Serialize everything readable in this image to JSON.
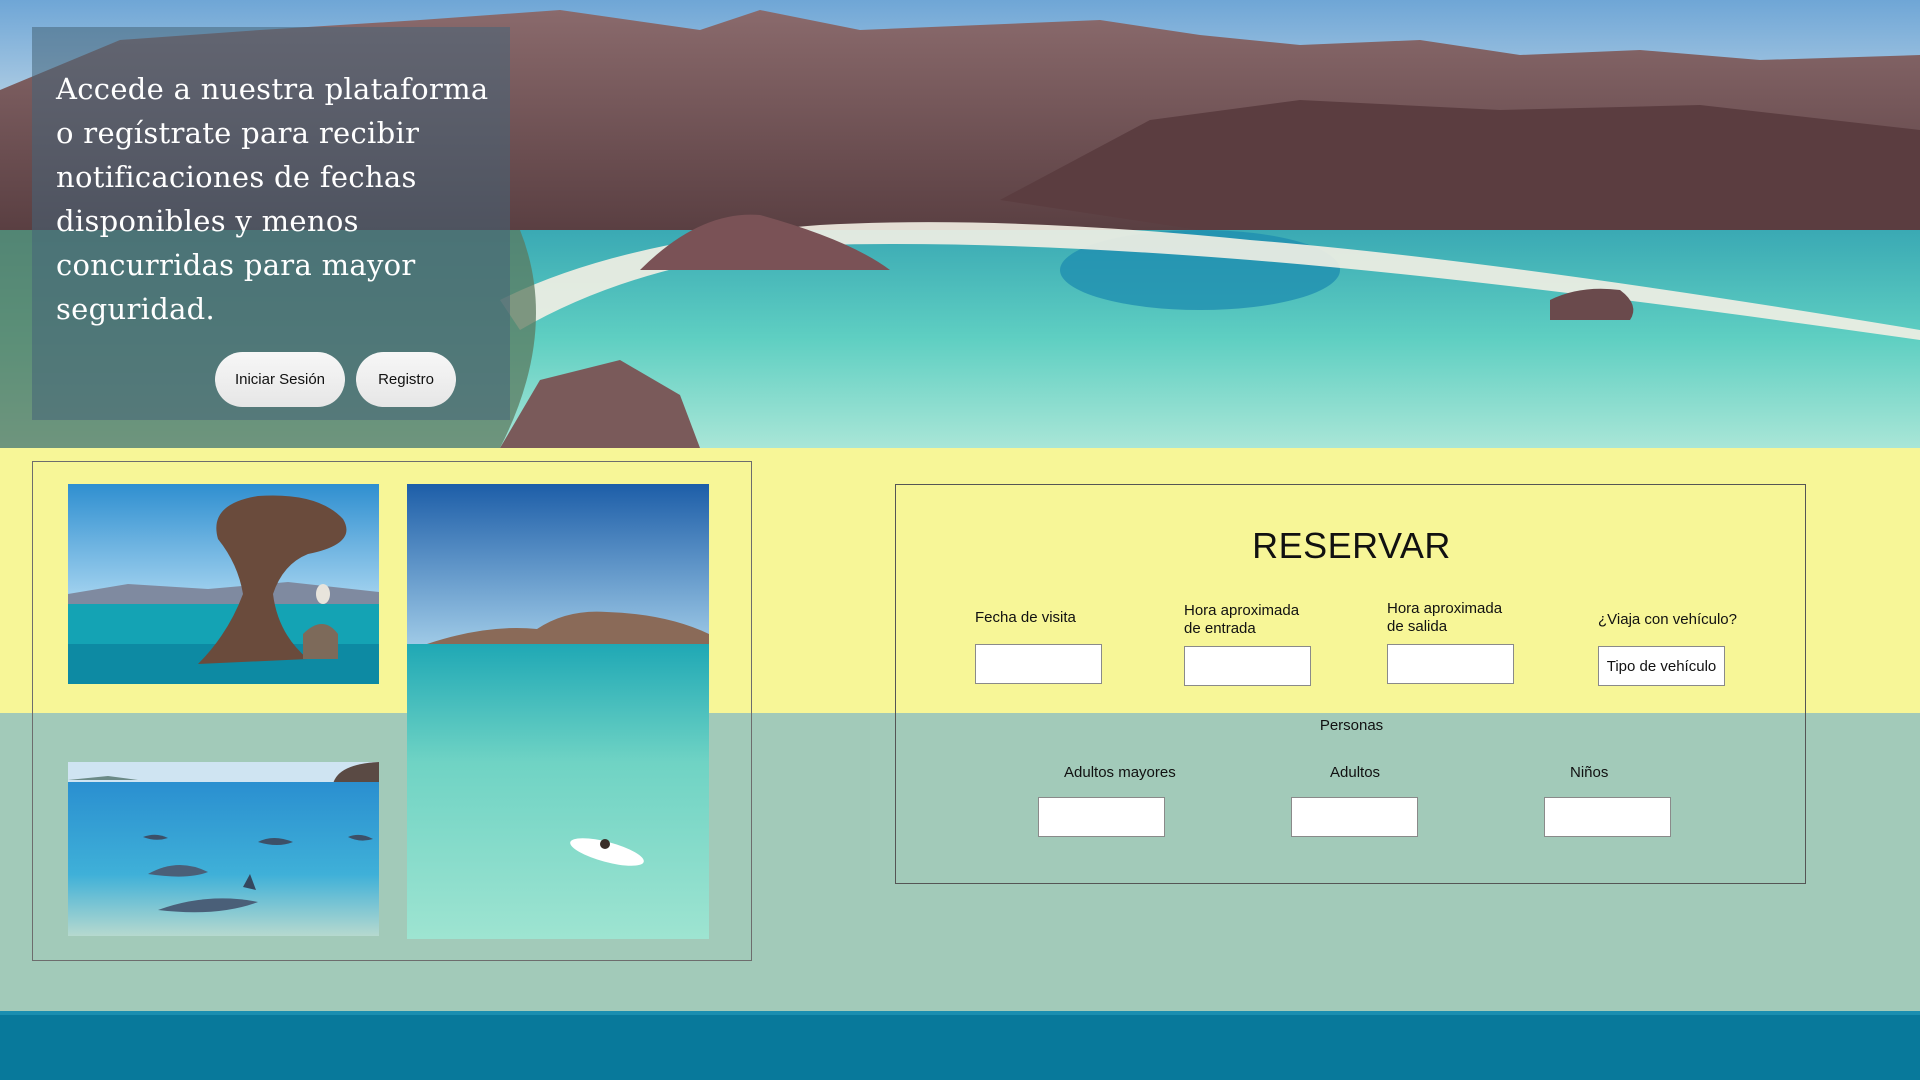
{
  "hero": {
    "intro_text": "Accede a nuestra plataforma o regístrate para recibir notificaciones de fechas disponibles y menos concurridas para mayor seguridad.",
    "login_label": "Iniciar Sesión",
    "register_label": "Registro"
  },
  "booking": {
    "title": "RESERVAR",
    "fields": {
      "visit_date_label": "Fecha de visita",
      "entry_time_label_line1": "Hora aproximada",
      "entry_time_label_line2": "de entrada",
      "exit_time_label_line1": "Hora aproximada",
      "exit_time_label_line2": "de salida",
      "vehicle_question_label": "¿Viaja con vehículo?",
      "vehicle_type_value": "Tipo de vehículo"
    },
    "people": {
      "section_label": "Personas",
      "seniors_label": "Adultos mayores",
      "adults_label": "Adultos",
      "children_label": "Niños"
    }
  },
  "colors": {
    "band_yellow": "#f7f697",
    "band_green": "#a2cab9",
    "footer": "#08799b"
  }
}
